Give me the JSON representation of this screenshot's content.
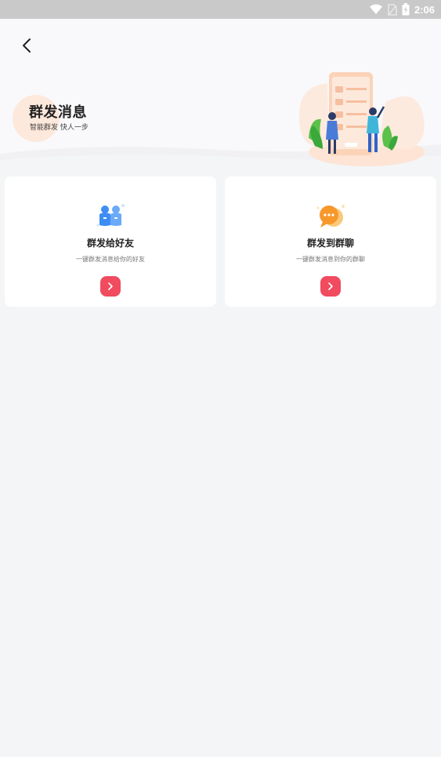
{
  "status_bar": {
    "time": "2:06"
  },
  "header": {
    "title": "群发消息",
    "subtitle": "智能群发 快人一步"
  },
  "cards": [
    {
      "title": "群发给好友",
      "description": "一键群发消息给你的好友",
      "icon": "friends-icon"
    },
    {
      "title": "群发到群聊",
      "description": "一键群发消息到你的群聊",
      "icon": "chat-bubble-icon"
    }
  ],
  "colors": {
    "accent": "#f04b5f",
    "background": "#f4f5f7",
    "card": "#ffffff"
  }
}
